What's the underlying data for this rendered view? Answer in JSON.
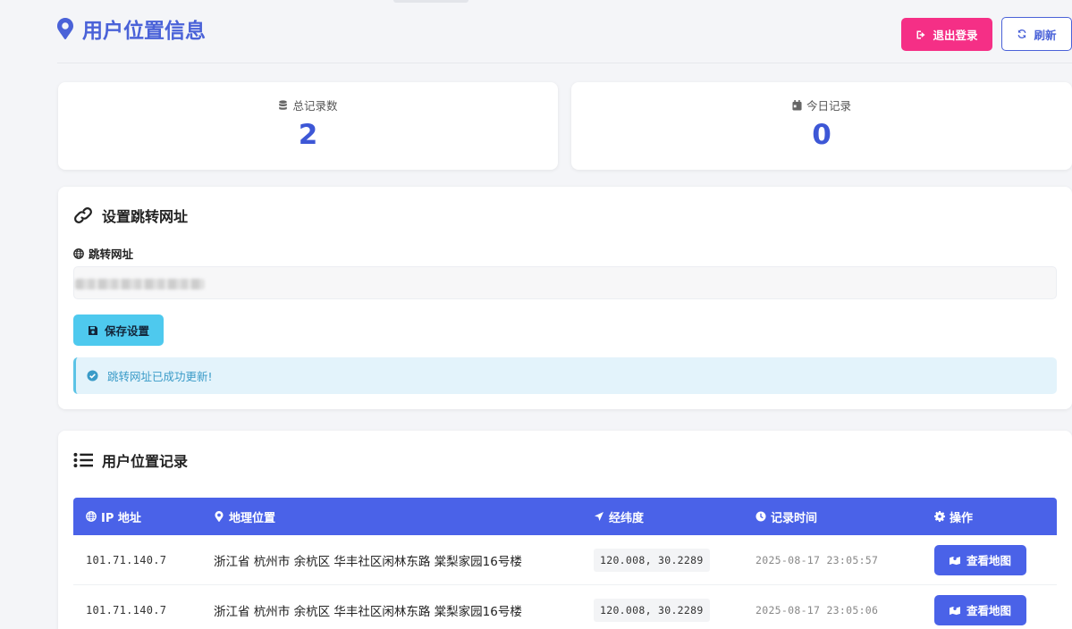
{
  "header": {
    "title": "用户位置信息",
    "logout_label": "退出登录",
    "refresh_label": "刷新"
  },
  "stats": {
    "total_label": "总记录数",
    "total_value": "2",
    "today_label": "今日记录",
    "today_value": "0"
  },
  "redirect": {
    "section_title": "设置跳转网址",
    "field_label": "跳转网址",
    "input_value": "",
    "save_label": "保存设置",
    "success_message": "跳转网址已成功更新!"
  },
  "records": {
    "section_title": "用户位置记录",
    "columns": {
      "ip": "IP 地址",
      "location": "地理位置",
      "coords": "经纬度",
      "time": "记录时间",
      "action": "操作"
    },
    "rows": [
      {
        "ip": "101.71.140.7",
        "location": "浙江省 杭州市 余杭区 华丰社区闲林东路 棠梨家园16号楼",
        "coords": "120.008, 30.2289",
        "time": "2025-08-17 23:05:57",
        "action_label": "查看地图"
      },
      {
        "ip": "101.71.140.7",
        "location": "浙江省 杭州市 余杭区 华丰社区闲林东路 棠梨家园16号楼",
        "coords": "120.008, 30.2289",
        "time": "2025-08-17 23:05:06",
        "action_label": "查看地图"
      }
    ]
  },
  "colors": {
    "primary": "#4a62e8",
    "logout": "#f52f86",
    "save": "#4ec9ee",
    "alert_bg": "#e3f3fb",
    "alert_text": "#3a9bc8"
  }
}
